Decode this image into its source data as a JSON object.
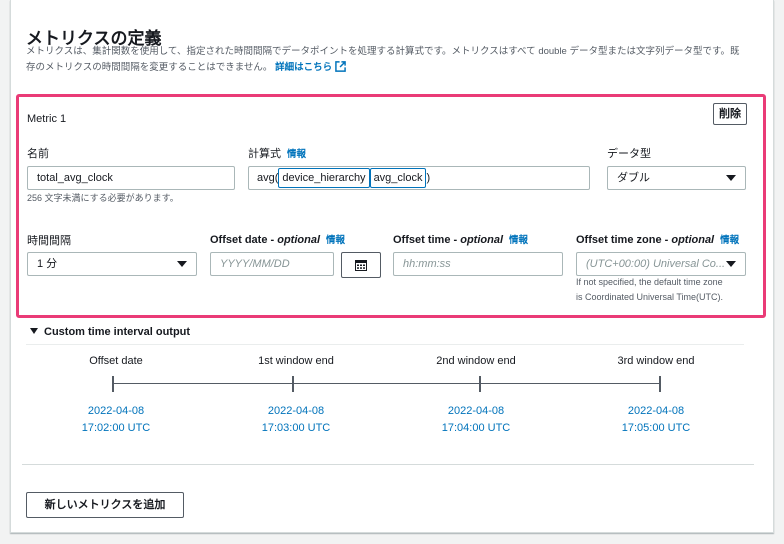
{
  "section": {
    "title": "メトリクスの定義",
    "desc_line1": "メトリクスは、集計関数を使用して、指定された時間間隔でデータポイントを処理する計算式です。メトリクスはすべて double データ型または文字列データ型です。既",
    "desc_line2": "存のメトリクスの時間間隔を変更することはできません。",
    "learn_more": "詳細はこちら",
    "learn_more_icon": "external-link-icon"
  },
  "metric": {
    "header": "Metric 1",
    "delete_label": "削除",
    "name_label": "名前",
    "name_value": "total_avg_clock",
    "name_hint": "256 文字未満にする必要があります。",
    "formula_label": "計算式",
    "formula_info": "情報",
    "formula_prefix": "avg(",
    "formula_chip1": "device_hierarchy",
    "formula_chip2": "avg_clock",
    "formula_suffix": ")",
    "datatype_label": "データ型",
    "datatype_value": "ダブル",
    "interval_label": "時間間隔",
    "interval_value": "1 分",
    "offset_date_label": "Offset date - ",
    "offset_date_opt": "optional",
    "offset_date_info": "情報",
    "offset_date_placeholder": "YYYY/MM/DD",
    "calendar_icon": "calendar-icon",
    "offset_time_label": "Offset time - ",
    "offset_time_opt": "optional",
    "offset_time_info": "情報",
    "offset_time_placeholder": "hh:mm:ss",
    "offset_tz_label": "Offset time zone - ",
    "offset_tz_opt": "optional",
    "offset_tz_info": "情報",
    "offset_tz_placeholder": "(UTC+00:00) Universal Co...",
    "offset_tz_hint1": "If not specified, the default time zone",
    "offset_tz_hint2": "is Coordinated Universal Time(UTC)."
  },
  "output": {
    "toggle_label": "Custom time interval output",
    "columns": [
      {
        "head": "Offset date",
        "date": "2022-04-08",
        "time": "17:02:00 UTC"
      },
      {
        "head": "1st window end",
        "date": "2022-04-08",
        "time": "17:03:00 UTC"
      },
      {
        "head": "2nd window end",
        "date": "2022-04-08",
        "time": "17:04:00 UTC"
      },
      {
        "head": "3rd window end",
        "date": "2022-04-08",
        "time": "17:05:00 UTC"
      }
    ]
  },
  "add_metric_label": "新しいメトリクスを追加",
  "colors": {
    "accent_border": "#ea3b77",
    "link": "#0073bb"
  }
}
